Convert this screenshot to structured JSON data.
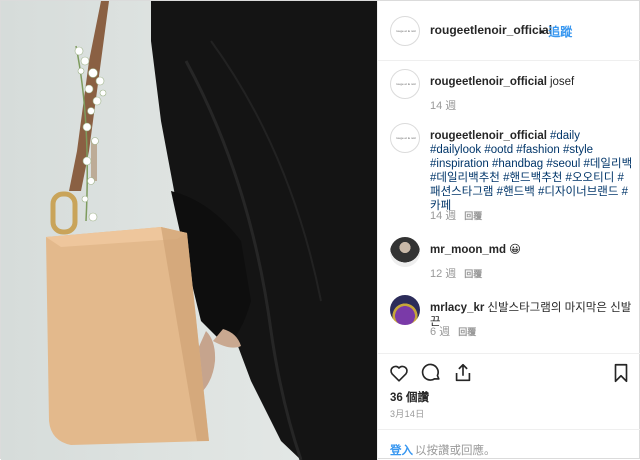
{
  "header": {
    "username": "rougeetlenoir_official",
    "separator": "•",
    "follow_label": "追蹤",
    "avatar_text": "rouge et le noir"
  },
  "comments": [
    {
      "user": "rougeetlenoir_official",
      "text": "josef",
      "time": "14 週",
      "reply": ""
    },
    {
      "user": "rougeetlenoir_official",
      "text": "#daily #dailylook #ootd #fashion #style #inspiration #handbag #seoul #데일리백 #데일리백추천 #핸드백추천 #오오티디 #패션스타그램 #핸드백 #디자이너브랜드 #카페",
      "time": "14 週",
      "reply": "回覆"
    },
    {
      "user": "mr_moon_md",
      "text": "😀",
      "time": "12 週",
      "reply": "回覆"
    },
    {
      "user": "mrlacy_kr",
      "text": "신발스타그램의 마지막은 신발끈",
      "time": "6 週",
      "reply": "回覆"
    }
  ],
  "actions": {
    "likes": "36 個讚",
    "date": "3月14日"
  },
  "login": {
    "link": "登入",
    "rest": "以按讚或回應。"
  },
  "colors": {
    "link_blue": "#3897f0",
    "hashtag": "#003569",
    "muted": "#999999",
    "bag_tan": "#e3b98c",
    "strap_brown": "#8a6043"
  }
}
